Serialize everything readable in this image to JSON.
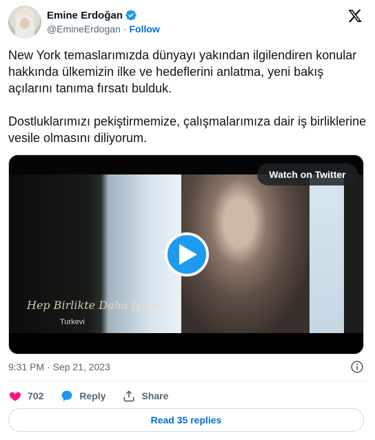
{
  "author": {
    "name": "Emine Erdoğan",
    "handle": "@EmineErdogan",
    "separator": "·",
    "follow_label": "Follow"
  },
  "tweet": {
    "paragraph_1": "New York temaslarımızda dünyayı yakından ilgilendiren konular hakkında ülkemizin ilke ve hedeflerini anlatma, yeni bakış açılarını tanıma fırsatı bulduk.",
    "paragraph_2": "Dostluklarımızı pekiştirmemize, çalışmalarımıza dair iş birliklerine vesile olmasını diliyorum."
  },
  "media": {
    "watch_label": "Watch on Twitter",
    "watermark_text": "Hep Birlikte Daha İyiye",
    "brand_text": "Turkevi"
  },
  "meta": {
    "timestamp": "9:31 PM · Sep 21, 2023"
  },
  "actions": {
    "likes_count": "702",
    "reply_label": "Reply",
    "share_label": "Share"
  },
  "footer": {
    "read_replies_label": "Read 35 replies"
  },
  "colors": {
    "accent": "#1d9bf0",
    "like": "#f91880",
    "link": "#006fd6"
  },
  "icons": [
    "verified-badge-icon",
    "x-logo-icon",
    "play-icon",
    "info-icon",
    "heart-icon",
    "reply-bubble-icon",
    "share-icon"
  ]
}
